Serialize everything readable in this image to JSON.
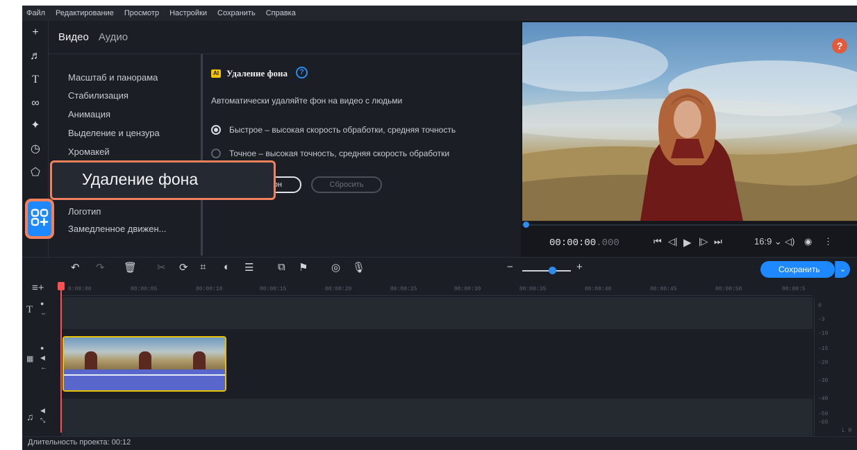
{
  "menu": [
    "Файл",
    "Редактирование",
    "Просмотр",
    "Настройки",
    "Сохранить",
    "Справка"
  ],
  "tabs": {
    "video": "Видео",
    "audio": "Аудио"
  },
  "categories": [
    "Масштаб и панорама",
    "Стабилизация",
    "Анимация",
    "Выделение и цензура",
    "Хромакей",
    "Логотип",
    "Замедленное движен..."
  ],
  "panel": {
    "ai_badge": "AI",
    "title": "Удаление фона",
    "help": "?",
    "description": "Автоматически удаляйте фон на видео с людьми",
    "option_fast": "Быстрое – высокая скорость обработки, средняя точность",
    "option_precise": "Точное – высокая точность, средняя скорость обработки",
    "apply_label": "фон",
    "reset_label": "Сбросить"
  },
  "callout": {
    "text": "Удаление фона"
  },
  "preview": {
    "help": "?",
    "timecode_main": "00:00:00",
    "timecode_ms": ".000",
    "aspect": "16:9 ⌄"
  },
  "timeline": {
    "save_label": "Сохранить",
    "ticks": [
      "0:00:00",
      "00:00:05",
      "00:00:10",
      "00:00:15",
      "00:00:20",
      "00:00:25",
      "00:00:30",
      "00:00:35",
      "00:00:40",
      "00:00:45",
      "00:00:50",
      "00:00:5"
    ],
    "meter_labels": [
      "0",
      "-3",
      "-10",
      "-15",
      "-20",
      "-30",
      "-40",
      "-50",
      "-60"
    ],
    "meter_lr": "L  R"
  },
  "status": {
    "duration": "Длительность проекта: 00:12"
  },
  "icons": {
    "rail": [
      "plus-icon",
      "music-icon",
      "text-icon",
      "transitions-icon",
      "magic-icon",
      "clock-icon",
      "sticker-icon",
      "effects-icon"
    ],
    "accent": "#1e88ff",
    "highlight": "#f0815c",
    "clip_border": "#e5c100",
    "playhead": "#ff4f4f"
  }
}
